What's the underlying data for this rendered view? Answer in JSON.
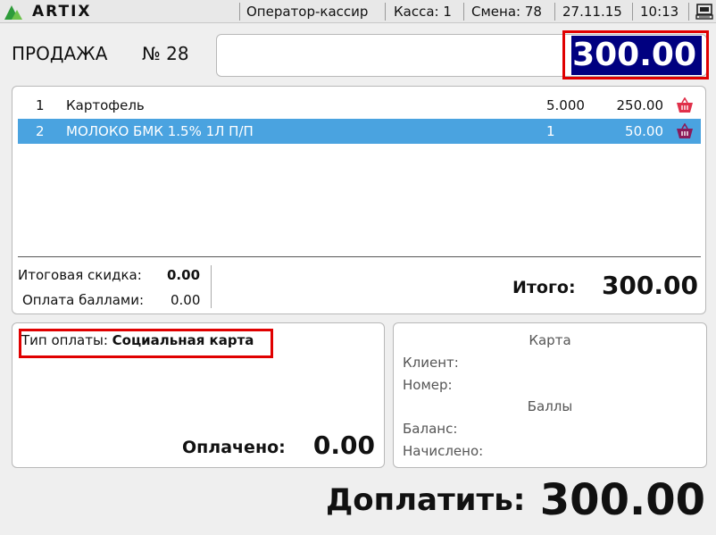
{
  "topbar": {
    "logo_text": "ARTIX",
    "operator": "Оператор-кассир",
    "register": "Касса: 1",
    "shift": "Смена: 78",
    "date": "27.11.15",
    "time": "10:13",
    "terminal_icon": "terminal-icon"
  },
  "sale": {
    "title": "ПРОДАЖА",
    "number": "№ 28",
    "amount": "300.00"
  },
  "items": [
    {
      "num": "1",
      "name": "Картофель",
      "qty": "5.000",
      "sum": "250.00",
      "icon": "basket-icon",
      "selected": false
    },
    {
      "num": "2",
      "name": "МОЛОКО БМК 1.5% 1Л П/П",
      "qty": "1",
      "sum": "50.00",
      "icon": "basket-icon",
      "selected": true
    }
  ],
  "summary": {
    "discount_label": "Итоговая скидка:",
    "discount_value": "0.00",
    "points_label": "Оплата баллами:",
    "points_value": "0.00",
    "total_label": "Итого:",
    "total_value": "300.00"
  },
  "payment": {
    "type_label": "Тип оплаты:",
    "type_value": "Социальная карта",
    "paid_label": "Оплачено:",
    "paid_value": "0.00"
  },
  "card": {
    "title": "Карта",
    "client_label": "Клиент:",
    "number_label": "Номер:",
    "points_title": "Баллы",
    "balance_label": "Баланс:",
    "accrued_label": "Начислено:"
  },
  "due": {
    "label": "Доплатить:",
    "value": "300.00"
  },
  "colors": {
    "selected_row": "#4aa3e0",
    "amount_bg": "#000080",
    "highlight": "#e00000",
    "basket": "#e0304a"
  }
}
